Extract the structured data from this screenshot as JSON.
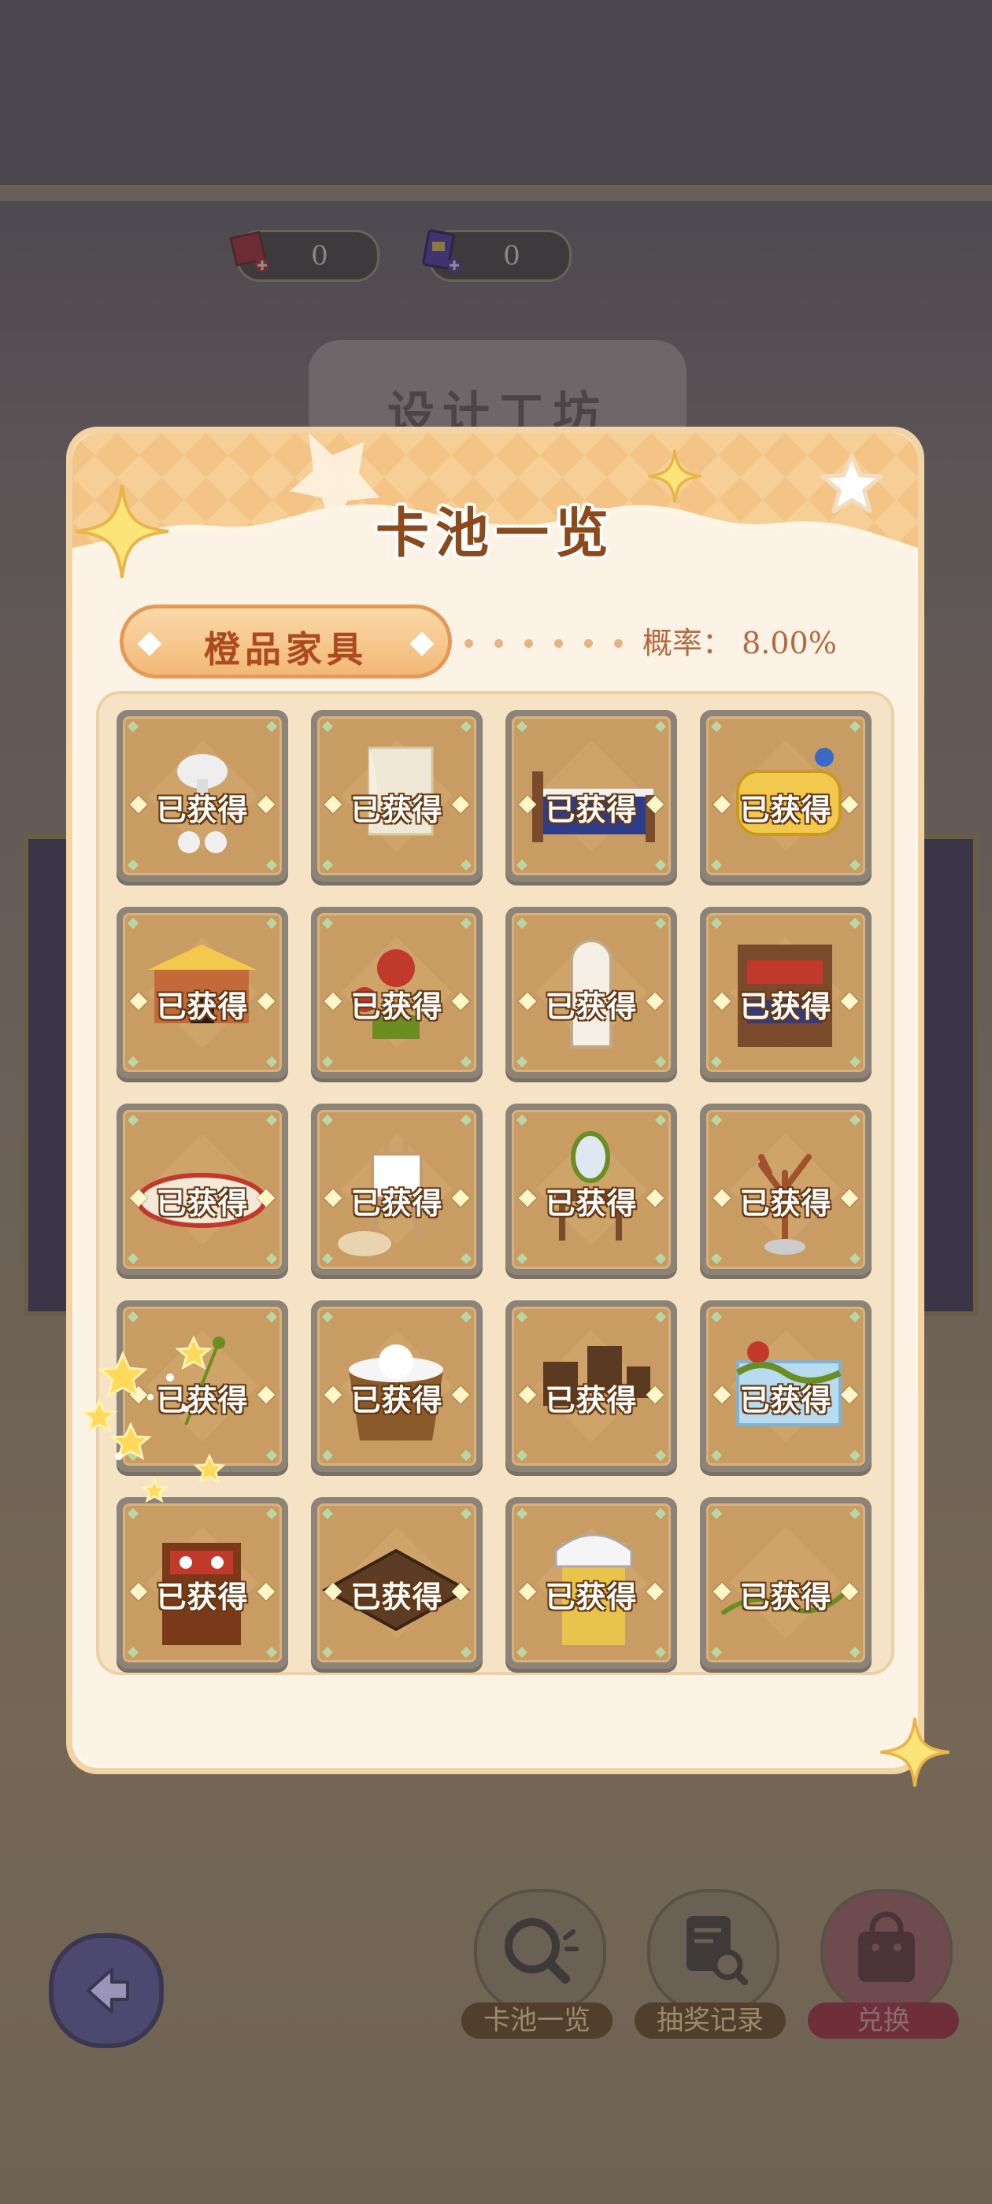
{
  "currencies": [
    {
      "icon": "red-ticket-icon",
      "value": "0"
    },
    {
      "icon": "purple-card-icon",
      "value": "0"
    }
  ],
  "background": {
    "workshop_title": "设计工坊",
    "buttons": [
      {
        "icon": "magnifier-icon",
        "label": "卡池一览"
      },
      {
        "icon": "record-search-icon",
        "label": "抽奖记录"
      },
      {
        "icon": "shopping-bag-icon",
        "label": "兑换"
      }
    ]
  },
  "modal": {
    "title": "卡池一览",
    "tier": "橙品家具",
    "rate_label": "概率：",
    "rate_value": "8.00%",
    "obtained_label": "已获得",
    "items": [
      {
        "icon": "mushroom-table-icon"
      },
      {
        "icon": "window-curtain-icon"
      },
      {
        "icon": "blue-bed-icon"
      },
      {
        "icon": "yellow-sofa-icon"
      },
      {
        "icon": "brick-oven-icon"
      },
      {
        "icon": "mushroom-stools-icon"
      },
      {
        "icon": "arched-mirror-icon"
      },
      {
        "icon": "bunk-bed-icon"
      },
      {
        "icon": "oval-rug-icon"
      },
      {
        "icon": "easel-palette-icon"
      },
      {
        "icon": "vanity-mirror-icon"
      },
      {
        "icon": "antler-lamp-icon"
      },
      {
        "icon": "plant-pot-icon"
      },
      {
        "icon": "bunny-basket-icon"
      },
      {
        "icon": "picture-frames-icon"
      },
      {
        "icon": "fish-tank-icon"
      },
      {
        "icon": "sushi-cabinet-icon"
      },
      {
        "icon": "wood-floor-mat-icon"
      },
      {
        "icon": "yellow-wardrobe-icon"
      },
      {
        "icon": "vine-decoration-icon"
      }
    ]
  }
}
